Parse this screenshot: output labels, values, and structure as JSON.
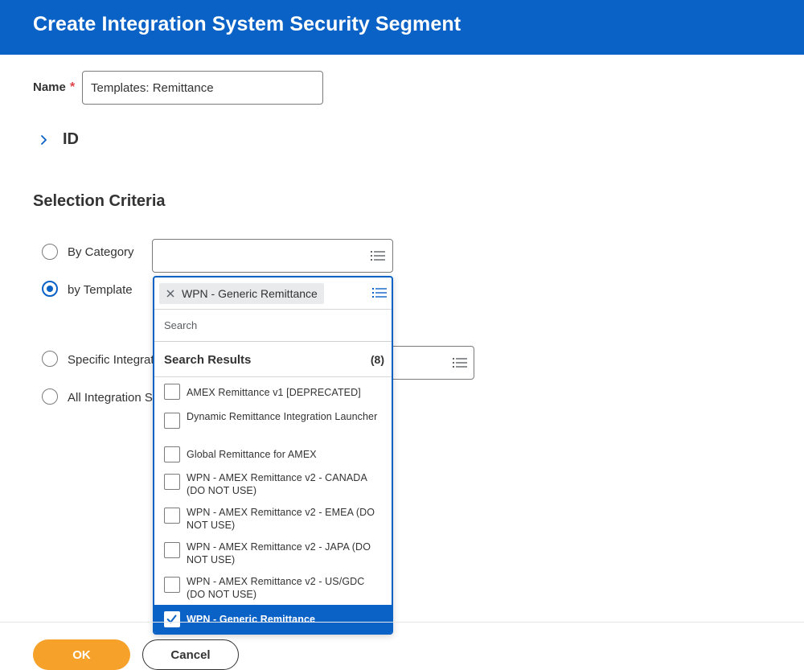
{
  "header": {
    "title": "Create Integration System Security Segment"
  },
  "name_field": {
    "label": "Name",
    "required_mark": "*",
    "value": "Templates: Remittance"
  },
  "id_section": {
    "label": "ID"
  },
  "selection_criteria": {
    "title": "Selection Criteria",
    "options": [
      {
        "label": "By Category",
        "selected": false
      },
      {
        "label": "by Template",
        "selected": true
      },
      {
        "label": "Specific Integrat",
        "selected": false
      },
      {
        "label": "All Integration S",
        "selected": false
      }
    ]
  },
  "template_prompt": {
    "selected_pill": "WPN - Generic Remittance",
    "search_placeholder": "Search",
    "results_title": "Search Results",
    "results_count": "(8)",
    "items": [
      {
        "label": "AMEX Remittance v1 [DEPRECATED]",
        "checked": false
      },
      {
        "label": "Dynamic Remittance Integration Launcher",
        "checked": false
      },
      {
        "label": "Global Remittance for AMEX",
        "checked": false
      },
      {
        "label": "WPN - AMEX Remittance v2 - CANADA (DO NOT USE)",
        "checked": false
      },
      {
        "label": "WPN - AMEX Remittance v2 - EMEA (DO NOT USE)",
        "checked": false
      },
      {
        "label": "WPN - AMEX Remittance v2 - JAPA (DO NOT USE)",
        "checked": false
      },
      {
        "label": "WPN - AMEX Remittance v2 - US/GDC (DO NOT USE)",
        "checked": false
      },
      {
        "label": "WPN - Generic Remittance",
        "checked": true
      }
    ]
  },
  "footer": {
    "ok_label": "OK",
    "cancel_label": "Cancel"
  },
  "colors": {
    "brand_blue": "#0b62c6",
    "ok_orange": "#f5a12a",
    "required_red": "#de4448"
  }
}
